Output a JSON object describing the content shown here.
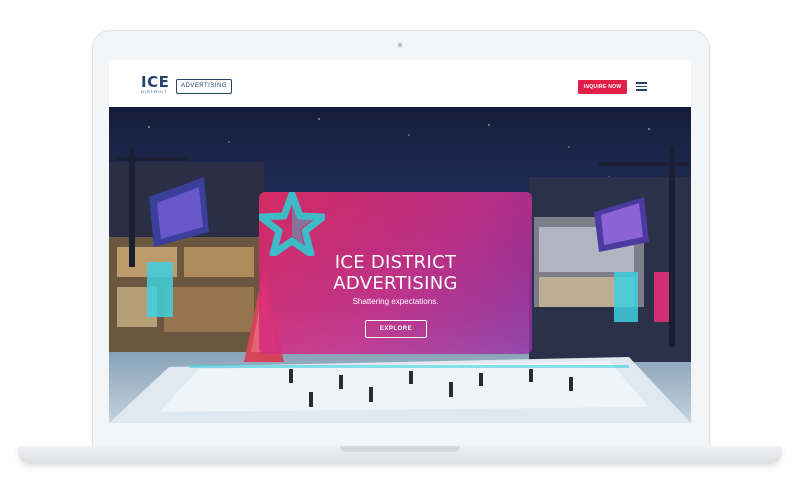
{
  "header": {
    "logo_main": "ICE",
    "logo_sub": "DISTRICT",
    "badge": "ADVERTISING",
    "inquire_label": "INQUIRE NOW",
    "menu_icon": "hamburger-icon"
  },
  "hero": {
    "title_line1": "ICE DISTRICT",
    "title_line2": "ADVERTISING",
    "subtitle": "Shattering expectations.",
    "explore_label": "EXPLORE",
    "logo_icon": "star-icon"
  },
  "colors": {
    "brand_navy": "#24446d",
    "brand_red": "#e1204a",
    "overlay_pink": "#e22b64",
    "overlay_purple": "#9630aa",
    "star_teal": "#3fbac7"
  }
}
